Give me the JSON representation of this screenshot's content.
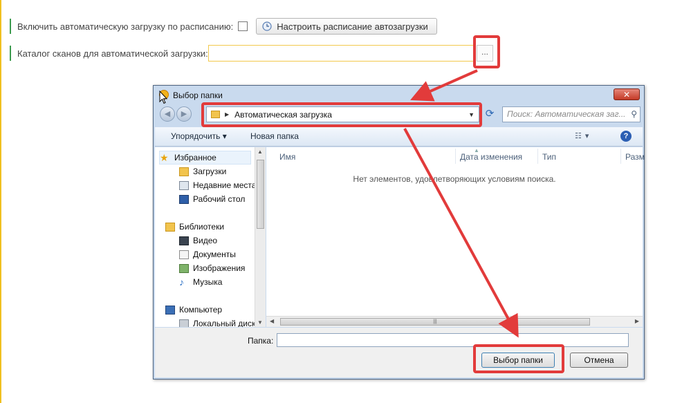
{
  "form": {
    "auto_load_label": "Включить автоматическую загрузку по расписанию:",
    "schedule_button": "Настроить расписание автозагрузки",
    "scan_dir_label": "Каталог сканов для автоматической загрузки:",
    "scan_dir_value": "",
    "browse_button": "..."
  },
  "dialog": {
    "title": "Выбор папки",
    "close": "✕",
    "address": "Автоматическая загрузка",
    "search_placeholder": "Поиск: Автоматическая заг...",
    "toolbar": {
      "organize": "Упорядочить ▾",
      "new_folder": "Новая папка"
    },
    "nav": {
      "favorites": "Избранное",
      "downloads": "Загрузки",
      "recent": "Недавние места",
      "desktop": "Рабочий стол",
      "libraries": "Библиотеки",
      "video": "Видео",
      "documents": "Документы",
      "images": "Изображения",
      "music": "Музыка",
      "computer": "Компьютер",
      "local_disk": "Локальный диск"
    },
    "columns": {
      "name": "Имя",
      "date": "Дата изменения",
      "type": "Тип",
      "size": "Разм"
    },
    "empty_message": "Нет элементов, удовлетворяющих условиям поиска.",
    "folder_label": "Папка:",
    "folder_value": "",
    "ok_button": "Выбор папки",
    "cancel_button": "Отмена"
  },
  "colors": {
    "highlight": "#e23b3b",
    "green_marker": "#3c9a4e",
    "yellow_field": "#f2c94c"
  }
}
